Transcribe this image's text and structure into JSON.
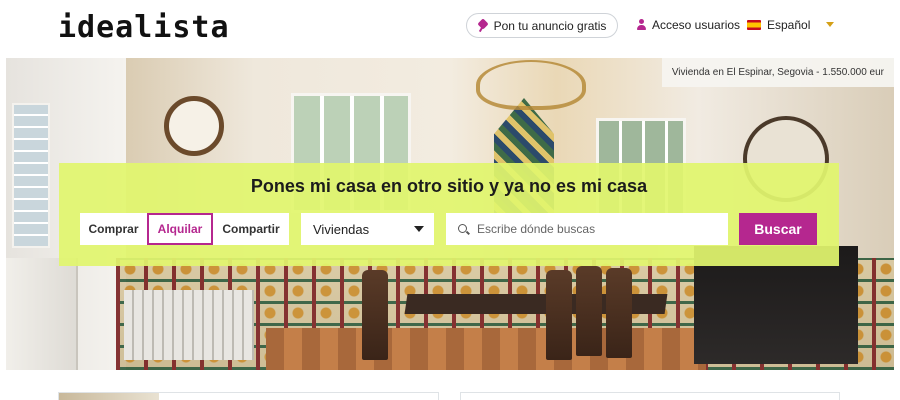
{
  "header": {
    "logo": "idealista",
    "post_ad_label": "Pon tu anuncio gratis",
    "post_ad_icon": "pin-icon",
    "login_label": "Acceso usuarios",
    "login_icon": "person-icon",
    "language_label": "Español",
    "language_icon": "spain-flag-icon"
  },
  "hero": {
    "caption": "Vivienda en El Espinar, Segovia - 1.550.000 eur"
  },
  "search": {
    "headline": "Pones mi casa en otro sitio y ya no es mi casa",
    "operations": [
      {
        "label": "Comprar",
        "active": false
      },
      {
        "label": "Alquilar",
        "active": true
      },
      {
        "label": "Compartir",
        "active": false
      }
    ],
    "property_type": "Viviendas",
    "location_placeholder": "Escribe dónde buscas",
    "submit_label": "Buscar"
  },
  "colors": {
    "accent": "#b5278f",
    "panel": "#e1f56e"
  }
}
